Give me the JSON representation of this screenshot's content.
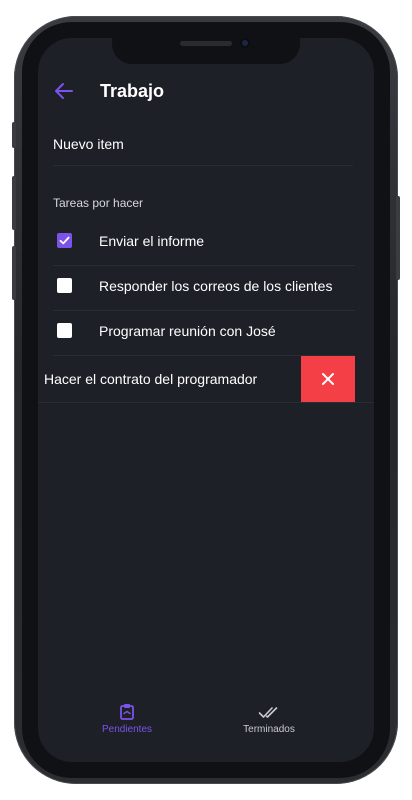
{
  "header": {
    "title": "Trabajo",
    "back_icon": "arrow-left-icon"
  },
  "new_item": {
    "placeholder": "Nuevo item"
  },
  "section": {
    "label": "Tareas por hacer"
  },
  "tasks": [
    {
      "label": "Enviar el informe",
      "checked": true
    },
    {
      "label": "Responder los correos de los clientes",
      "checked": false
    },
    {
      "label": "Programar reunión con José",
      "checked": false
    },
    {
      "label": "Hacer el contrato del programador",
      "swiped": true,
      "action_icon": "close-icon"
    }
  ],
  "tabs": [
    {
      "label": "Pendientes",
      "icon": "clipboard-icon",
      "active": true
    },
    {
      "label": "Terminados",
      "icon": "double-check-icon",
      "active": false
    }
  ],
  "colors": {
    "background": "#1e2028",
    "accent": "#7b53ea",
    "danger": "#f43f47",
    "text": "#ffffff",
    "tab_inactive": "#c9cad0"
  }
}
